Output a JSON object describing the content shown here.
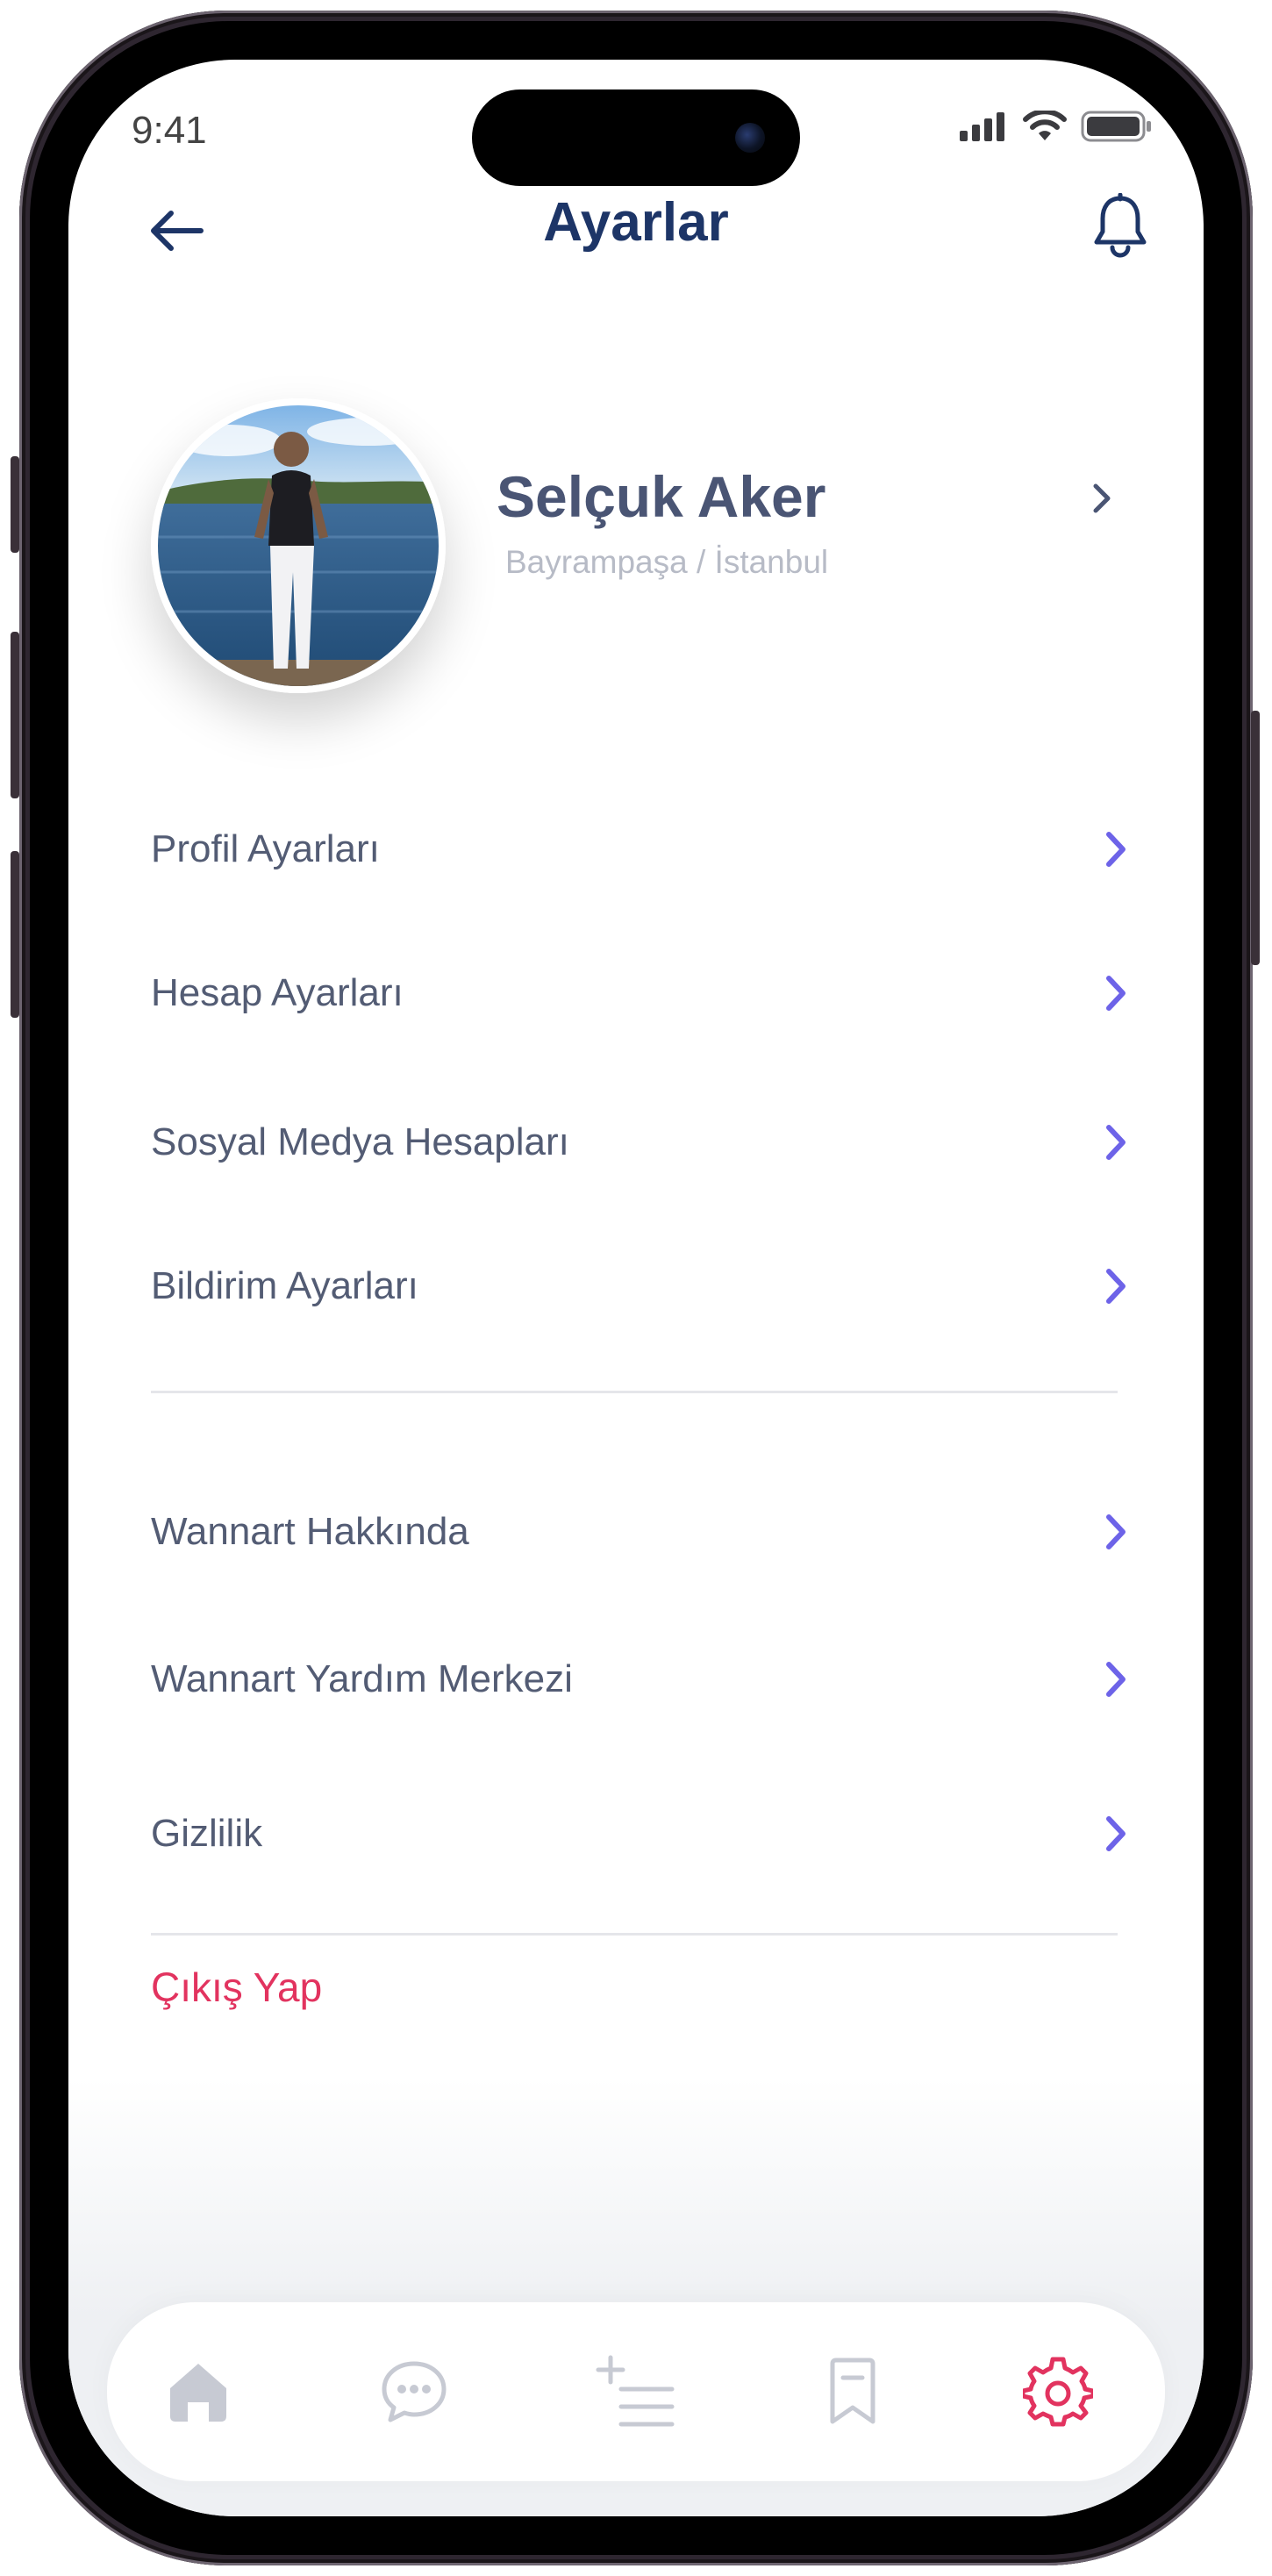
{
  "status_bar": {
    "time": "9:41"
  },
  "header": {
    "title": "Ayarlar"
  },
  "profile": {
    "name": "Selçuk Aker",
    "location": "Bayrampaşa / İstanbul"
  },
  "menu_group_1": [
    {
      "label": "Profil Ayarları"
    },
    {
      "label": "Hesap Ayarları"
    },
    {
      "label": "Sosyal Medya Hesapları"
    },
    {
      "label": "Bildirim Ayarları"
    }
  ],
  "menu_group_2": [
    {
      "label": "Wannart Hakkında"
    },
    {
      "label": "Wannart Yardım Merkezi"
    },
    {
      "label": "Gizlilik"
    }
  ],
  "logout": {
    "label": "Çıkış Yap"
  },
  "tab_bar": {
    "tabs": [
      {
        "icon": "home-icon",
        "active": false
      },
      {
        "icon": "chat-icon",
        "active": false
      },
      {
        "icon": "add-post-icon",
        "active": false
      },
      {
        "icon": "bookmark-icon",
        "active": false
      },
      {
        "icon": "settings-icon",
        "active": true
      }
    ]
  },
  "colors": {
    "title": "#1d3567",
    "text": "#535c74",
    "chevron": "#6d63e8",
    "danger": "#e2335f",
    "inactive_tab": "#c7cad3"
  }
}
